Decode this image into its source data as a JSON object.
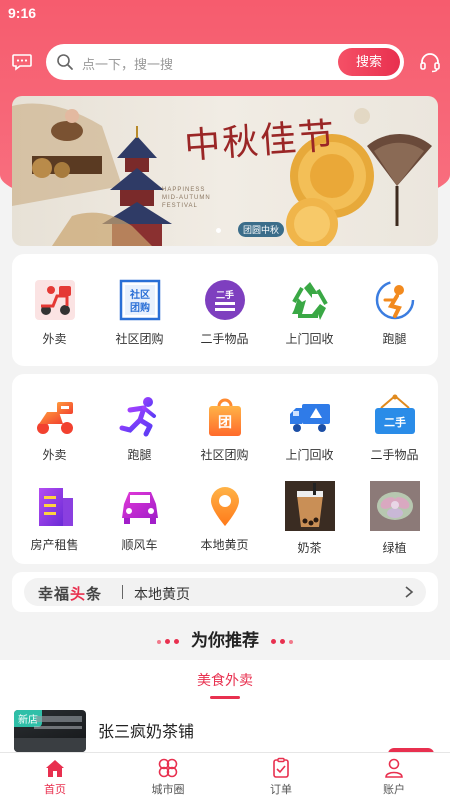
{
  "status_bar": {
    "time": "9:16"
  },
  "search": {
    "placeholder": "点一下，搜一搜",
    "button_label": "搜索"
  },
  "banner": {
    "calligraphy": "中秋佳节",
    "english_line1": "HAPPINESS",
    "english_line2": "MID-AUTUMN",
    "english_line3": "FESTIVAL",
    "stamp": "团圆中秋"
  },
  "quick_services": [
    {
      "label": "外卖",
      "icon": "delivery-scooter-icon"
    },
    {
      "label": "社区团购",
      "icon": "community-group-buy-icon"
    },
    {
      "label": "二手物品",
      "icon": "second-hand-icon"
    },
    {
      "label": "上门回收",
      "icon": "recycle-icon"
    },
    {
      "label": "跑腿",
      "icon": "errand-runner-icon"
    }
  ],
  "categories": [
    {
      "label": "外卖",
      "icon": "scooter-icon"
    },
    {
      "label": "跑腿",
      "icon": "running-man-icon"
    },
    {
      "label": "社区团购",
      "icon": "shopping-bag-icon"
    },
    {
      "label": "上门回收",
      "icon": "truck-icon"
    },
    {
      "label": "二手物品",
      "icon": "second-hand-sign-icon"
    },
    {
      "label": "房产租售",
      "icon": "building-icon"
    },
    {
      "label": "顺风车",
      "icon": "car-icon"
    },
    {
      "label": "本地黄页",
      "icon": "location-pin-icon"
    },
    {
      "label": "奶茶",
      "icon": "milk-tea-photo"
    },
    {
      "label": "绿植",
      "icon": "succulent-photo"
    }
  ],
  "news": {
    "logo_part1": "幸福",
    "logo_part2": "头",
    "logo_part3": "条",
    "text": "本地黄页"
  },
  "recommend": {
    "title": "为你推荐",
    "tab": "美食外卖"
  },
  "shop": {
    "tag": "新店",
    "name": "张三疯奶茶铺"
  },
  "tabbar": [
    {
      "label": "首页",
      "icon": "home-icon",
      "active": true
    },
    {
      "label": "城市圈",
      "icon": "city-circle-icon",
      "active": false
    },
    {
      "label": "订单",
      "icon": "orders-icon",
      "active": false
    },
    {
      "label": "账户",
      "icon": "account-icon",
      "active": false
    }
  ],
  "colors": {
    "brand": "#e8304f",
    "header": "#f65c6e"
  }
}
